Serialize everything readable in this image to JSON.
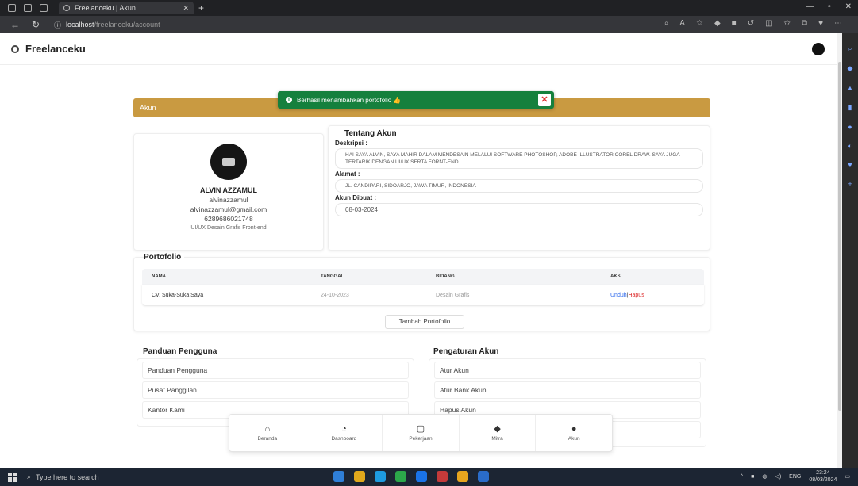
{
  "browser": {
    "tab_title": "Freelanceku | Akun",
    "url_host": "localhost",
    "url_path": "/freelanceku/account"
  },
  "header": {
    "brand": "Freelanceku"
  },
  "banner": {
    "label": "Akun"
  },
  "toast": {
    "message": "Berhasil menambahkan portofolio 👍"
  },
  "profile": {
    "name": "ALVIN AZZAMUL",
    "username": "alvinazzamul",
    "email": "alvinazzamul@gmail.com",
    "phone": "6289686021748",
    "field": "UI/UX Desain Grafis Front-end"
  },
  "about": {
    "title": "Tentang Akun",
    "description_label": "Deskripsi :",
    "description": "HAI SAYA ALVIN, SAYA MAHIR DALAM MENDESAIN MELALUI SOFTWARE PHOTOSHOP, ADOBE ILLUSTRATOR COREL DRAW. SAYA JUGA TERTARIK DENGAN UI/UX SERTA FORNT-END",
    "address_label": "Alamat :",
    "address": "JL. CANDIPARI, SIDOARJO, JAWA TIMUR, INDONESIA",
    "created_label": "Akun Dibuat :",
    "created": "08-03-2024"
  },
  "portfolio": {
    "title": "Portofolio",
    "columns": [
      "NAMA",
      "TANGGAL",
      "BIDANG",
      "AKSI"
    ],
    "rows": [
      {
        "nama": "CV. Suka-Suka Saya",
        "tanggal": "24-10-2023",
        "bidang": "Desain Grafis",
        "unduh": "Unduh",
        "sep": "|",
        "hapus": "Hapus"
      }
    ],
    "add_button": "Tambah Portofolio"
  },
  "guide": {
    "title": "Panduan Pengguna",
    "items": [
      "Panduan Pengguna",
      "Pusat Panggilan",
      "Kantor Kami"
    ]
  },
  "settings": {
    "title": "Pengaturan Akun",
    "items": [
      "Atur Akun",
      "Atur Bank Akun",
      "Hapus Akun"
    ]
  },
  "bottom_nav": [
    {
      "label": "Beranda",
      "icon": "⌂"
    },
    {
      "label": "Dashboard",
      "icon": "◔"
    },
    {
      "label": "Pekerjaan",
      "icon": "▢"
    },
    {
      "label": "Mitra",
      "icon": "◆"
    },
    {
      "label": "Akun",
      "icon": "●"
    }
  ],
  "taskbar": {
    "search_placeholder": "Type here to search",
    "lang": "ENG",
    "time": "23:24",
    "date": "08/03/2024"
  }
}
